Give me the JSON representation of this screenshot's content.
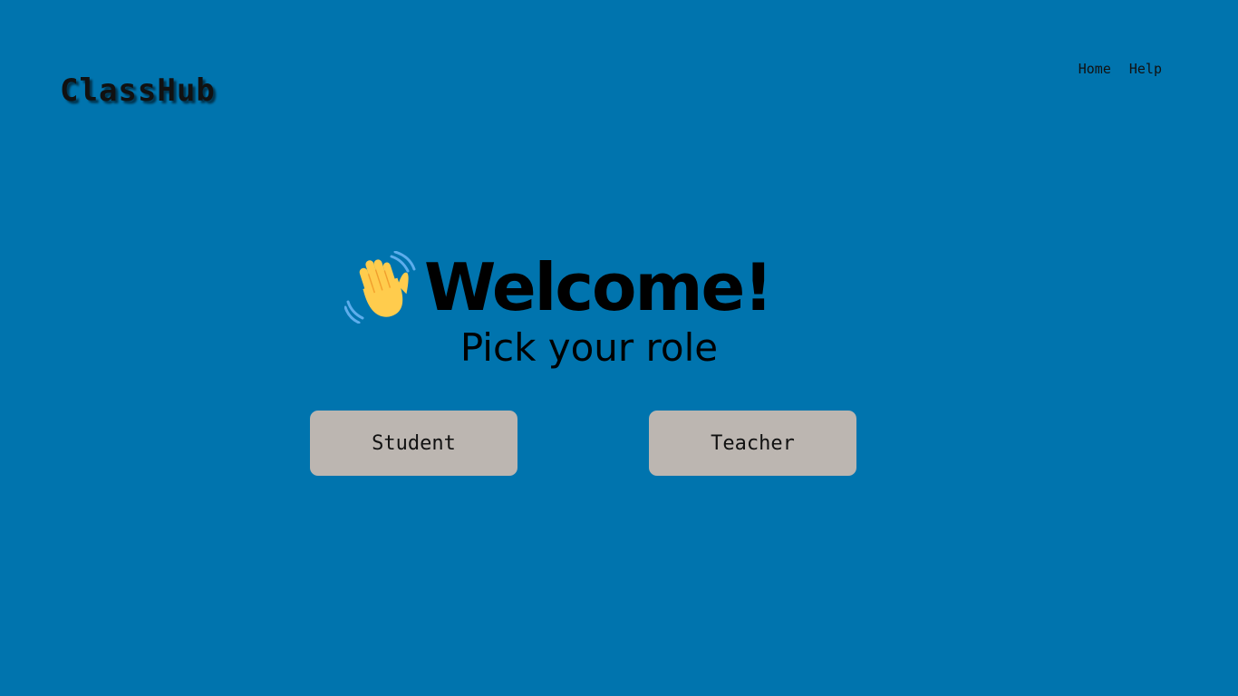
{
  "header": {
    "logo": "ClassHub",
    "nav": [
      {
        "label": "Home"
      },
      {
        "label": "Help"
      }
    ]
  },
  "hero": {
    "icon": "waving-hand-icon",
    "title": "Welcome!",
    "subtitle": "Pick your role"
  },
  "roles": [
    {
      "label": "Student"
    },
    {
      "label": "Teacher"
    }
  ],
  "colors": {
    "background": "#0074ae",
    "button": "#bcb6b1",
    "hand": "#ffcc4d",
    "motion_lines": "#5dadec"
  }
}
